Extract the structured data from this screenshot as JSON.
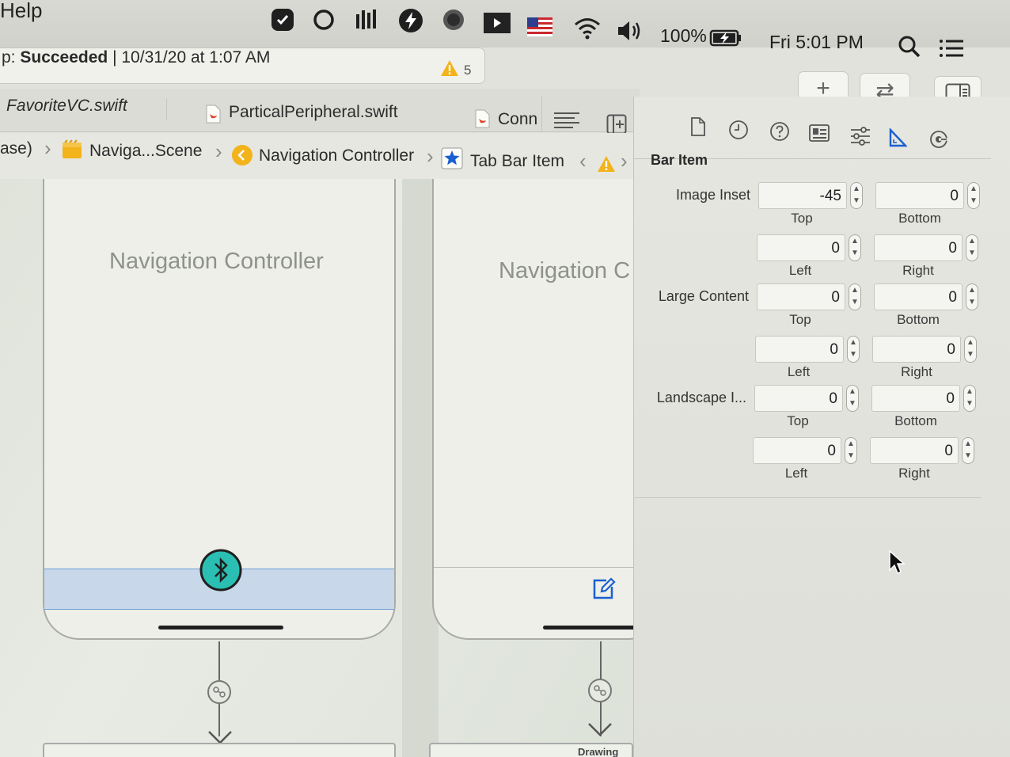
{
  "menubar": {
    "menu_item": "Help",
    "battery": "100%",
    "clock": "Fri 5:01 PM",
    "icons": [
      "checkbox-icon",
      "circle-icon",
      "audio-bars-icon",
      "bolt-icon",
      "dot-icon",
      "media-icon",
      "us-flag-icon",
      "wifi-icon",
      "volume-icon",
      "battery-icon",
      "search-icon",
      "list-icon"
    ]
  },
  "status": {
    "prefix": "p: ",
    "result": "Succeeded",
    "separator": " | ",
    "timestamp": "10/31/20 at 1:07 AM",
    "warnings": "5"
  },
  "toolbar": {
    "add": "+",
    "swap": "⇄"
  },
  "tabs": [
    {
      "label": "FavoriteVC.swift"
    },
    {
      "label": "ParticalPeripheral.swift"
    },
    {
      "label": "Conn"
    }
  ],
  "breadcrumb": {
    "items": [
      "ase)",
      "Naviga...Scene",
      "Navigation Controller",
      "Tab Bar Item"
    ]
  },
  "canvas": {
    "scene1_title": "Navigation Controller",
    "scene2_title": "Navigation C",
    "bottom_label_2": "Drawing"
  },
  "inspector": {
    "section_title": "Bar Item",
    "groups": [
      {
        "label": "Image Inset",
        "rows": [
          {
            "a": {
              "value": "-45",
              "label": "Top"
            },
            "b": {
              "value": "0",
              "label": "Bottom"
            }
          },
          {
            "a": {
              "value": "0",
              "label": "Left"
            },
            "b": {
              "value": "0",
              "label": "Right"
            }
          }
        ]
      },
      {
        "label": "Large Content",
        "rows": [
          {
            "a": {
              "value": "0",
              "label": "Top"
            },
            "b": {
              "value": "0",
              "label": "Bottom"
            }
          },
          {
            "a": {
              "value": "0",
              "label": "Left"
            },
            "b": {
              "value": "0",
              "label": "Right"
            }
          }
        ]
      },
      {
        "label": "Landscape I...",
        "rows": [
          {
            "a": {
              "value": "0",
              "label": "Top"
            },
            "b": {
              "value": "0",
              "label": "Bottom"
            }
          },
          {
            "a": {
              "value": "0",
              "label": "Left"
            },
            "b": {
              "value": "0",
              "label": "Right"
            }
          }
        ]
      }
    ]
  },
  "colors": {
    "accent": "#1a5fd0",
    "bluetooth": "#2bbfb3",
    "warning": "#f2b31b",
    "swift": "#e0462d"
  }
}
